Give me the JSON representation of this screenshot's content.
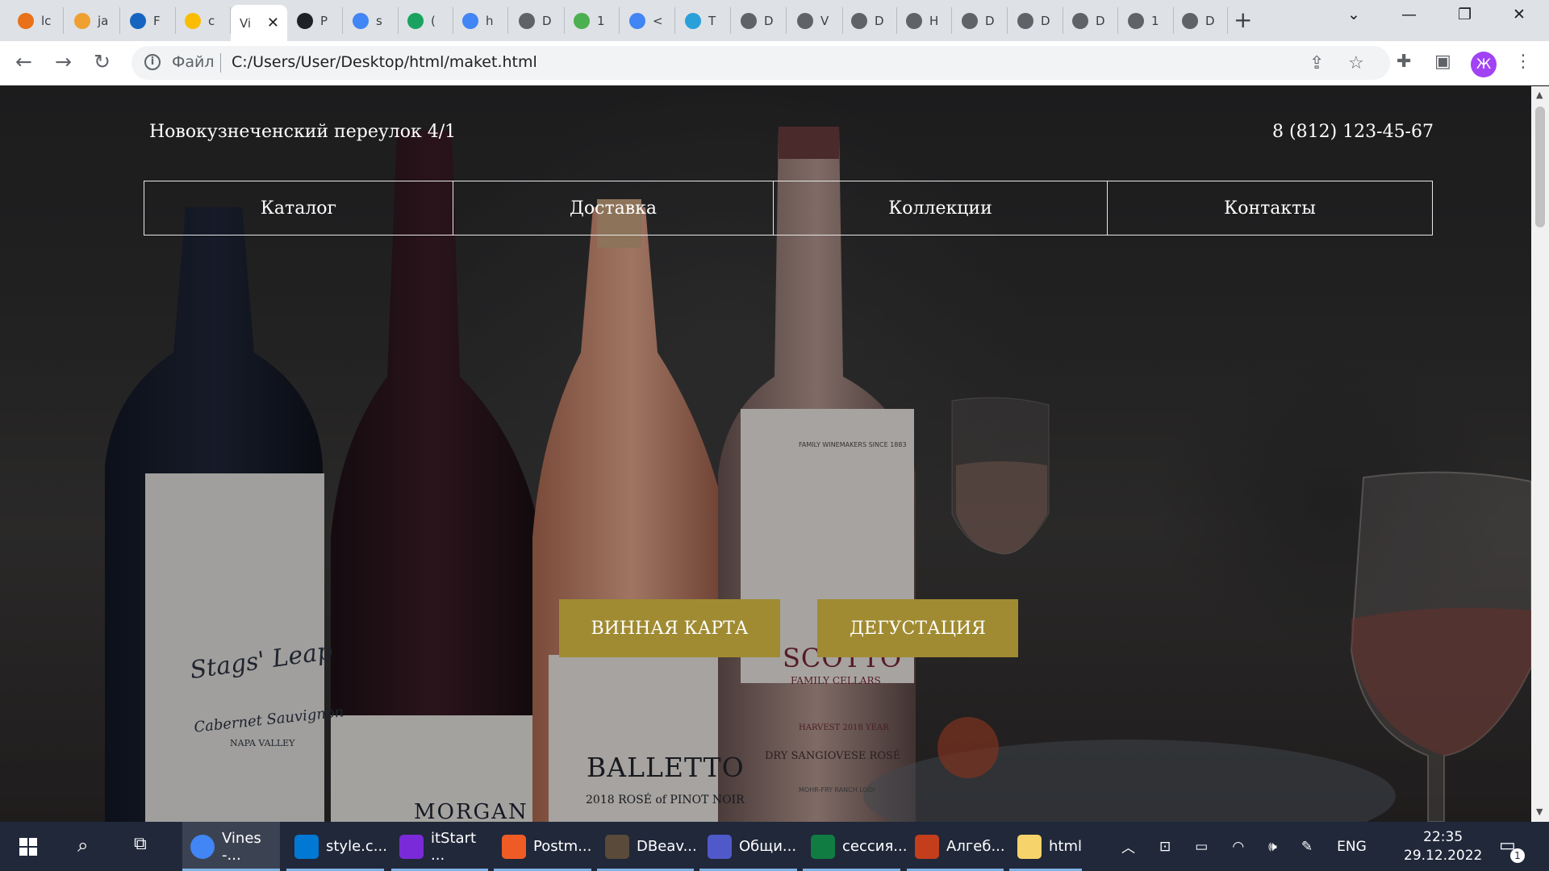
{
  "browser": {
    "tabs": [
      {
        "label": "lc",
        "color": "#e8711a"
      },
      {
        "label": "ja",
        "color": "#f0a030"
      },
      {
        "label": "F",
        "color": "#1565c0"
      },
      {
        "label": "c",
        "color": "#fbbc04"
      },
      {
        "label": "Vi",
        "color": "#ffffff",
        "active": true
      },
      {
        "label": "P",
        "color": "#202124"
      },
      {
        "label": "s",
        "color": "#4285f4"
      },
      {
        "label": "(",
        "color": "#1aa260"
      },
      {
        "label": "h",
        "color": "#4285f4"
      },
      {
        "label": "D",
        "color": "#5f6368"
      },
      {
        "label": "1",
        "color": "#4caf50"
      },
      {
        "label": "<",
        "color": "#4285f4"
      },
      {
        "label": "T",
        "color": "#29a0da"
      },
      {
        "label": "D",
        "color": "#5f6368"
      },
      {
        "label": "V",
        "color": "#5f6368"
      },
      {
        "label": "D",
        "color": "#5f6368"
      },
      {
        "label": "H",
        "color": "#5f6368"
      },
      {
        "label": "D",
        "color": "#5f6368"
      },
      {
        "label": "D",
        "color": "#5f6368"
      },
      {
        "label": "D",
        "color": "#5f6368"
      },
      {
        "label": "1",
        "color": "#5f6368"
      },
      {
        "label": "D",
        "color": "#5f6368"
      }
    ],
    "address": {
      "label": "Файл",
      "url": "C:/Users/User/Desktop/html/maket.html"
    },
    "profile_initial": "Ж"
  },
  "site": {
    "address": "Новокузнеченский переулок 4/1",
    "phone": "8 (812) 123-45-67",
    "menu": [
      "Каталог",
      "Доставка",
      "Коллекции",
      "Контакты"
    ],
    "buttons": {
      "wine_list": "ВИННАЯ КАРТА",
      "tasting": "ДЕГУСТАЦИЯ"
    },
    "accent_color": "#a08b32",
    "labels": {
      "bottle1": "Stags' Leap",
      "bottle1_sub": "Cabernet Sauvignon",
      "bottle1_region": "NAPA VALLEY",
      "bottle2": "MORGAN",
      "bottle3": "BALLETTO",
      "bottle3_sub": "2018 ROSÉ of PINOT NOIR",
      "bottle4": "SCOTTO",
      "bottle4_sub": "FAMILY CELLARS",
      "bottle4_top": "FAMILY WINEMAKERS SINCE 1883",
      "bottle4_harvest": "HARVEST 2018 YEAR",
      "bottle4_type": "DRY SANGIOVESE ROSÉ",
      "bottle4_ranch": "MOHR-FRY RANCH LODI"
    }
  },
  "taskbar": {
    "apps": [
      {
        "label": "Vines -...",
        "color": "#4285f4"
      },
      {
        "label": "style.c...",
        "color": "#0078d4"
      },
      {
        "label": "itStart ...",
        "color": "#7a2ad8"
      },
      {
        "label": "Postm...",
        "color": "#ef5b25"
      },
      {
        "label": "DBeav...",
        "color": "#5a4a3a"
      },
      {
        "label": "Общи...",
        "color": "#5059c9"
      },
      {
        "label": "сессия...",
        "color": "#107c41"
      },
      {
        "label": "Алгеб...",
        "color": "#c43e1c"
      },
      {
        "label": "html",
        "color": "#f6d36b"
      }
    ],
    "language": "ENG",
    "time": "22:35",
    "date": "29.12.2022",
    "notifications": "1"
  }
}
